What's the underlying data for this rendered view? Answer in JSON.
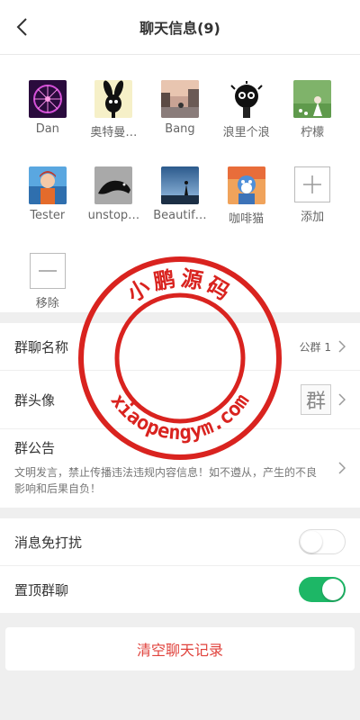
{
  "header": {
    "title": "聊天信息(9)",
    "back_icon": "back-chevron-icon"
  },
  "members": [
    {
      "name": "Dan",
      "avatar": "ferris-wheel-avatar"
    },
    {
      "name": "奥特曼…",
      "avatar": "black-rabbit-avatar"
    },
    {
      "name": "Bang",
      "avatar": "street-photo-avatar"
    },
    {
      "name": "浪里个浪",
      "avatar": "soot-sprite-avatar"
    },
    {
      "name": "柠檬",
      "avatar": "girl-field-avatar"
    },
    {
      "name": "Tester",
      "avatar": "anime-boy-avatar"
    },
    {
      "name": "unstop…",
      "avatar": "black-panther-avatar"
    },
    {
      "name": "Beautif…",
      "avatar": "sky-silhouette-avatar"
    },
    {
      "name": "咖啡猫",
      "avatar": "blue-cat-avatar"
    }
  ],
  "actions": {
    "add_label": "添加",
    "remove_label": "移除"
  },
  "settings": {
    "group_name_label": "群聊名称",
    "group_name_value": "公群 1",
    "group_avatar_label": "群头像",
    "group_avatar_char": "群",
    "announcement_label": "群公告",
    "announcement_text": "文明发言，禁止传播违法违规内容信息！如不遵从，产生的不良影响和后果自负！"
  },
  "toggles": {
    "mute_label": "消息免打扰",
    "mute_on": false,
    "pin_label": "置顶群聊",
    "pin_on": true
  },
  "clear_label": "清空聊天记录",
  "watermark": {
    "top_text": "小鹏源码",
    "bottom_text": "xiaopengym.com"
  },
  "colors": {
    "accent_green": "#1db766",
    "danger_red": "#e0433d",
    "stamp_red": "#d9231f"
  }
}
